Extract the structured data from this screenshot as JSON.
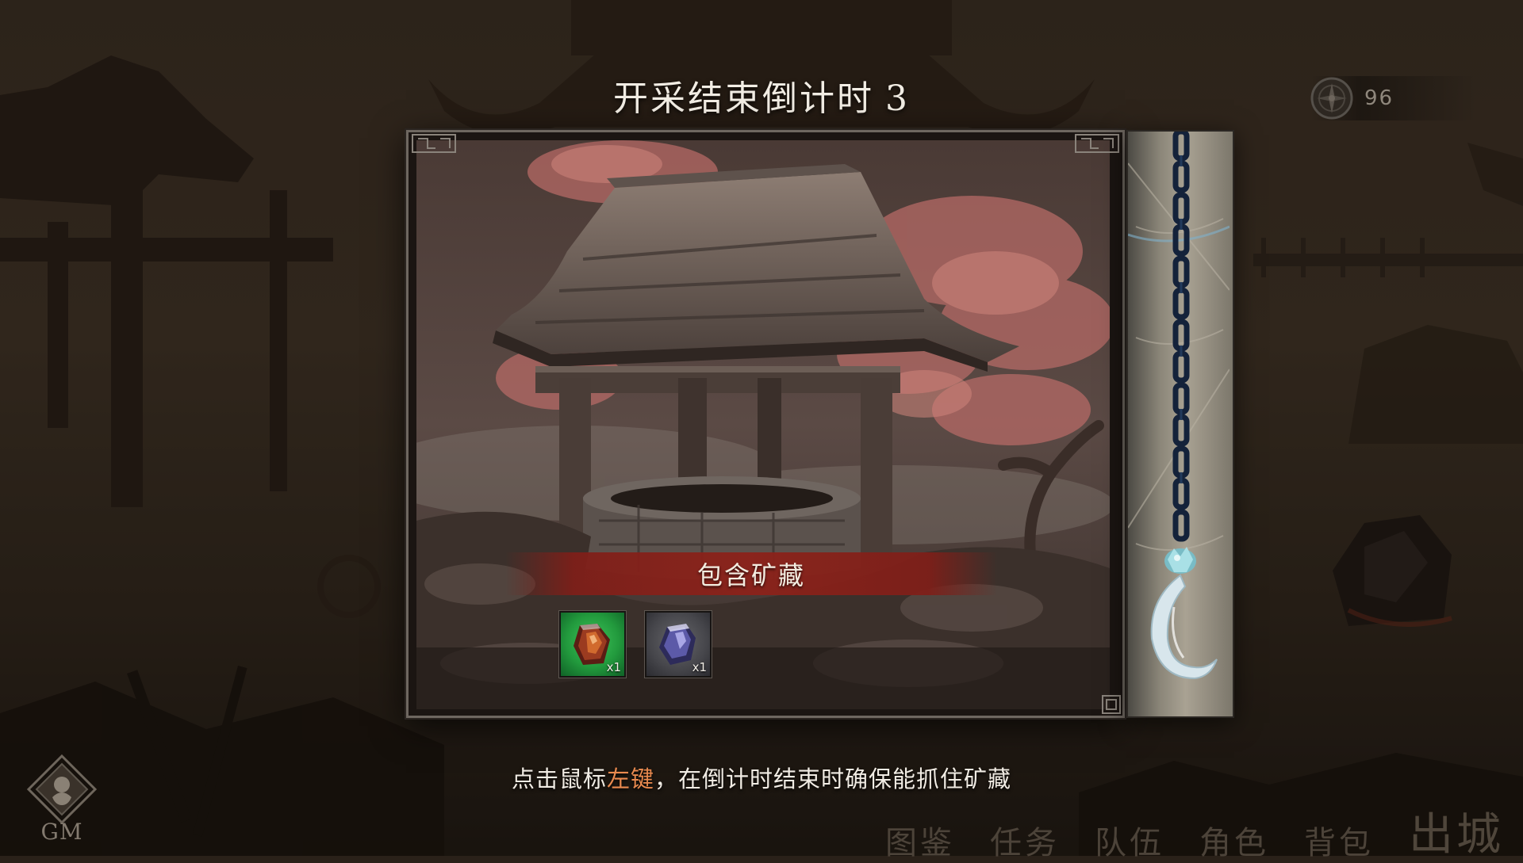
{
  "header": {
    "countdown_label": "开采结束倒计时",
    "countdown_value": "3"
  },
  "currency": {
    "icon": "compass-coin-icon",
    "value": "96"
  },
  "panel": {
    "scene": "well-pavilion",
    "banner_label": "包含矿藏",
    "items": [
      {
        "icon": "amber-ore-icon",
        "rarity_color": "#2fae4b",
        "quantity": "x1"
      },
      {
        "icon": "crystal-ore-icon",
        "rarity_color": "#4f4f55",
        "quantity": "x1"
      }
    ]
  },
  "hint": {
    "before": "点击鼠标",
    "key": "左键",
    "after": "，在倒计时结束时确保能抓住矿藏"
  },
  "gm": {
    "label": "GM"
  },
  "nav": {
    "items": [
      "图鉴",
      "任务",
      "队伍",
      "角色",
      "背包"
    ],
    "exit": "出城"
  },
  "colors": {
    "accent_orange": "#e98a4f",
    "banner_red": "#8c2218",
    "text_light": "#f2ede4"
  }
}
